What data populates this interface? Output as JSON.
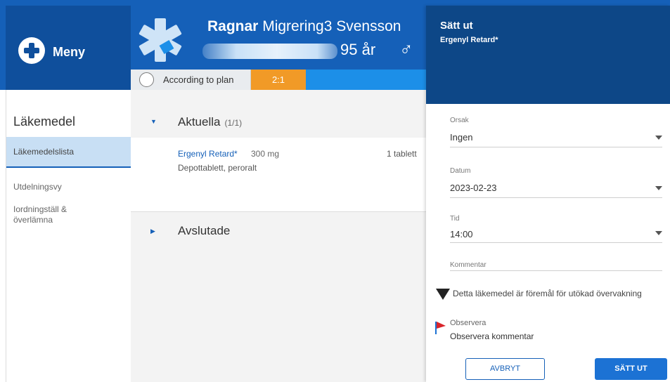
{
  "menu": {
    "label": "Meny",
    "logo_icon": "plus-cross-icon"
  },
  "patient": {
    "first_name": "Ragnar",
    "rest_name": "Migrering3 Svensson",
    "age": "95 år",
    "gender_icon": "male-symbol-icon",
    "gender_glyph": "♂"
  },
  "status": {
    "plan_label": "According to plan",
    "ratio": "2:1"
  },
  "nav": {
    "title": "Läkemedel",
    "items": [
      {
        "label": "Läkemedelslista"
      },
      {
        "label": "Utdelningsvy"
      },
      {
        "label": "Iordningställ & överlämna"
      }
    ]
  },
  "main": {
    "current_title": "Aktuella",
    "current_count": "(1/1)",
    "medication": {
      "name": "Ergenyl Retard*",
      "dose": "300 mg",
      "form": "Depottablett, peroralt",
      "amount": "1 tablett"
    },
    "ended_title": "Avslutade"
  },
  "panel": {
    "title": "Sätt ut",
    "subtitle": "Ergenyl Retard*",
    "reason": {
      "label": "Orsak",
      "value": "Ingen"
    },
    "date": {
      "label": "Datum",
      "value": "2023-02-23"
    },
    "time": {
      "label": "Tid",
      "value": "14:00"
    },
    "comment": {
      "label": "Kommentar",
      "value": ""
    },
    "monitoring_text": "Detta läkemedel är föremål för utökad övervakning",
    "observe_label": "Observera",
    "observe_text": "Observera kommentar",
    "cancel_label": "AVBRYT",
    "submit_label": "SÄTT UT"
  },
  "colors": {
    "header_blue": "#1560b8",
    "panel_header": "#0d4787",
    "accent_orange": "#f19a27",
    "link_blue": "#1560b8"
  }
}
